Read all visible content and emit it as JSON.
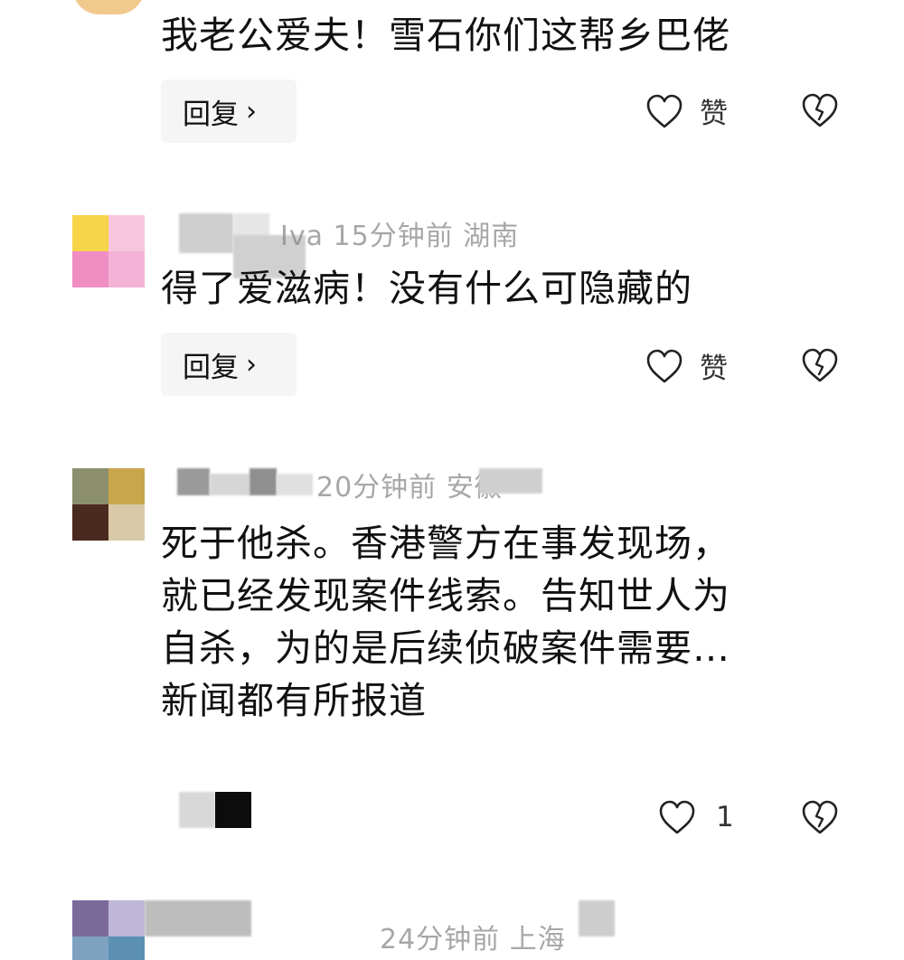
{
  "comments": [
    {
      "text_lines": [
        "我老公爱夫！雪石你们这帮乡巴佬"
      ],
      "reply_label": "回复",
      "reply_chevron": "›",
      "like_label": "赞",
      "colors": {
        "avatar": [
          "#f2c98c",
          "#e8b06a"
        ]
      }
    },
    {
      "meta": "Iva  15分钟前  湖南",
      "text_lines": [
        "得了爱滋病！没有什么可隐藏的"
      ],
      "reply_label": "回复",
      "reply_chevron": "›",
      "like_label": "赞",
      "colors": {
        "avatar": [
          "#f7d54a",
          "#f7c6dc",
          "#f08ec3",
          "#f4b3d6"
        ]
      }
    },
    {
      "meta": "20分钟前  安徽",
      "text_lines": [
        "死于他杀。香港警方在事发现场，",
        "就已经发现案件线索。告知世人为",
        "自杀，为的是后续侦破案件需要…",
        "新闻都有所报道"
      ],
      "like_count": "1",
      "colors": {
        "avatar": [
          "#8c8f6e",
          "#c9a64b",
          "#4a2a1e",
          "#d9c9a8"
        ]
      }
    },
    {
      "meta": "24分钟前  上海",
      "colors": {
        "avatar": [
          "#7a6a9a",
          "#bfb6d8",
          "#7fa2c0",
          "#5c8fb4"
        ]
      }
    }
  ],
  "icons": {
    "like": "heart-outline-icon",
    "dislike": "broken-heart-icon",
    "chevron": "chevron-right-icon"
  }
}
